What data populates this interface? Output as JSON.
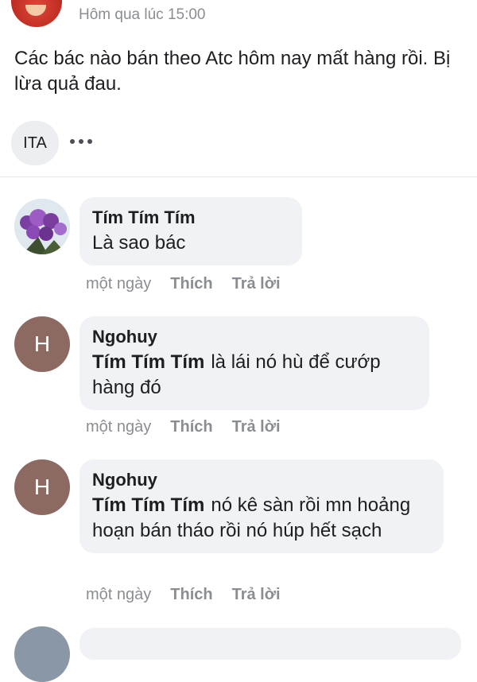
{
  "post": {
    "time": "Hôm qua lúc 15:00",
    "text": "Các bác nào bán theo Atc hôm nay mất hàng rồi. Bị lừa quả đau.",
    "tag_chip": "ITA"
  },
  "comments": [
    {
      "avatar_type": "photo",
      "avatar_letter": "",
      "author": "Tím Tím Tím",
      "mention": "",
      "text": "Là sao bác",
      "time": "một ngày",
      "like_label": "Thích",
      "reply_label": "Trả lời"
    },
    {
      "avatar_type": "letter",
      "avatar_letter": "H",
      "author": "Ngohuy",
      "mention": "Tím Tím Tím",
      "text": "là lái nó hù để cướp hàng đó",
      "time": "một ngày",
      "like_label": "Thích",
      "reply_label": "Trả lời"
    },
    {
      "avatar_type": "letter",
      "avatar_letter": "H",
      "author": "Ngohuy",
      "mention": "Tím Tím Tím",
      "text": "nó kê sàn rồi mn hoảng hoạn bán tháo rồi nó húp hết sạch",
      "time": "một ngày",
      "like_label": "Thích",
      "reply_label": "Trả lời"
    }
  ]
}
